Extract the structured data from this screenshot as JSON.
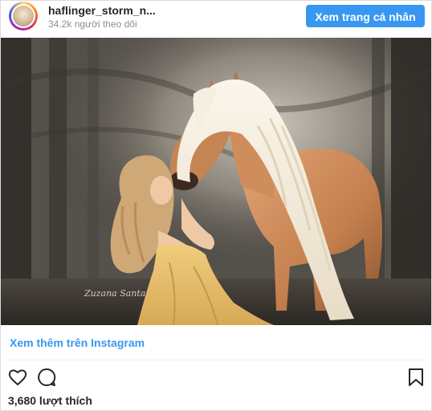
{
  "header": {
    "username": "haflinger_storm_n...",
    "followers": "34.2k người theo dõi",
    "view_profile_label": "Xem trang cá nhân",
    "avatar_icon": "profile-avatar"
  },
  "photo": {
    "watermark": "Zuzana Santa"
  },
  "footer": {
    "view_more_label": "Xem thêm trên Instagram",
    "likes": "3,680 lượt thích",
    "icons": [
      "heart-icon",
      "comment-icon",
      "bookmark-icon"
    ]
  },
  "colors": {
    "accent": "#3897f0",
    "text": "#262626",
    "muted": "#8e8e8e",
    "border": "#dbdbdb"
  }
}
